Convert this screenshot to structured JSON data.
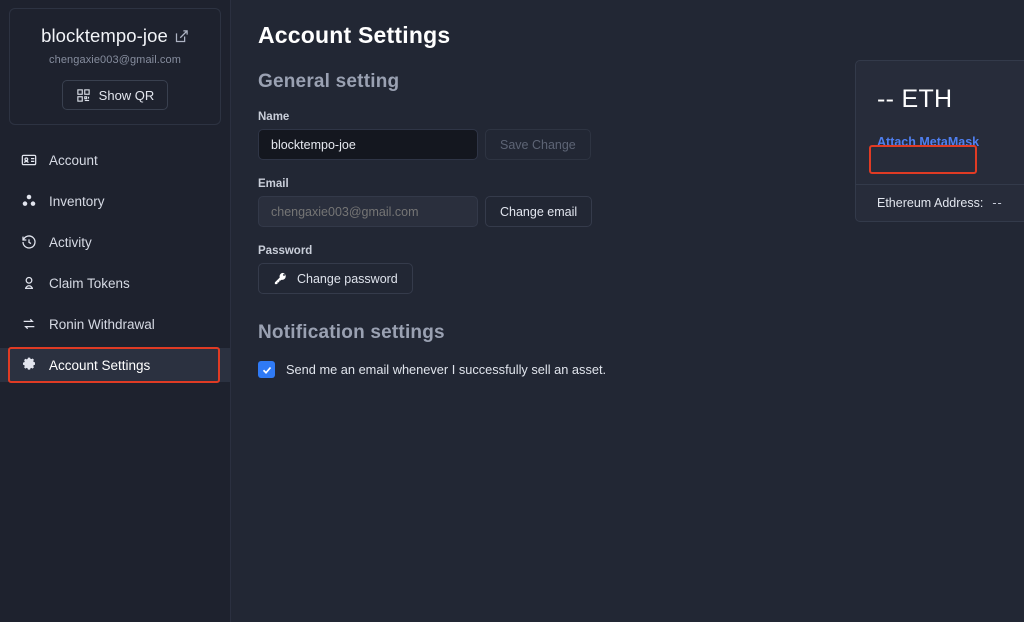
{
  "profile": {
    "name": "blocktempo-joe",
    "email": "chengaxie003@gmail.com",
    "edit_icon": "edit-square-icon",
    "qr_button": {
      "label": "Show QR",
      "icon": "qr-code-icon"
    }
  },
  "sidebar": {
    "items": [
      {
        "label": "Account",
        "icon": "id-card-icon",
        "active": false
      },
      {
        "label": "Inventory",
        "icon": "cubes-icon",
        "active": false
      },
      {
        "label": "Activity",
        "icon": "history-clock-icon",
        "active": false
      },
      {
        "label": "Claim Tokens",
        "icon": "token-badge-icon",
        "active": false
      },
      {
        "label": "Ronin Withdrawal",
        "icon": "swap-arrows-icon",
        "active": false
      },
      {
        "label": "Account Settings",
        "icon": "gear-icon",
        "active": true
      }
    ]
  },
  "main": {
    "page_title": "Account Settings",
    "general_section_title": "General setting",
    "fields": {
      "name": {
        "label": "Name",
        "value": "blocktempo-joe",
        "placeholder": "Name",
        "button": {
          "label": "Save Change",
          "disabled": true
        }
      },
      "email": {
        "label": "Email",
        "value": "chengaxie003@gmail.com",
        "placeholder": "chengaxie003@gmail.com",
        "disabled": true,
        "button": {
          "label": "Change email",
          "disabled": false
        }
      },
      "password": {
        "label": "Password",
        "button": {
          "label": "Change password",
          "icon": "key-icon"
        }
      }
    },
    "notification_section_title": "Notification settings",
    "notification": {
      "checked": true,
      "label": "Send me an email whenever I successfully sell an asset."
    }
  },
  "eth_card": {
    "amount": "-- ETH",
    "attach_link": "Attach MetaMask",
    "address_label": "Ethereum Address:",
    "address_value": "--",
    "logo_icon": "ethereum-diamond-icon"
  },
  "annotations": {
    "sidebar_highlight": "account-settings-nav-item",
    "metamask_highlight": "attach-metamask-link",
    "color": "#e03b24"
  },
  "colors": {
    "sidebar_bg": "#1e222e",
    "main_bg": "#222734",
    "accent_blue": "#4f7ff0",
    "checkbox_blue": "#2f7af5",
    "annotation_red": "#e03b24"
  }
}
